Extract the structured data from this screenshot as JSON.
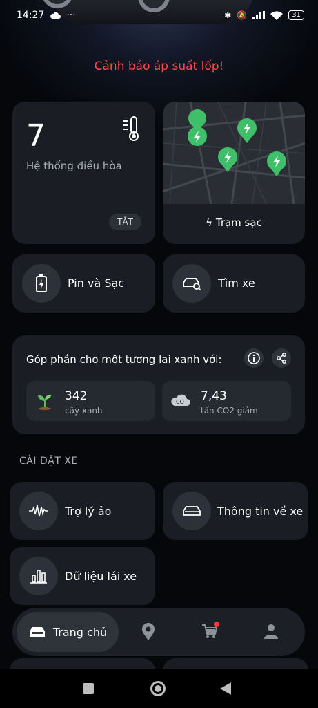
{
  "status_bar": {
    "time": "14:27",
    "battery": "31"
  },
  "alert": "Cảnh báo áp suất lốp!",
  "climate": {
    "value": "7",
    "label": "Hệ thống điều hòa",
    "off_label": "TẮT"
  },
  "charging_station": {
    "label": "Trạm sạc"
  },
  "battery_charge": {
    "label": "Pin và Sạc"
  },
  "find_car": {
    "label": "Tìm xe"
  },
  "eco": {
    "title": "Góp phần cho một tương lai xanh với:",
    "trees": {
      "value": "342",
      "unit": "cây xanh"
    },
    "co2": {
      "value": "7,43",
      "unit": "tấn CO2 giảm"
    }
  },
  "settings": {
    "title": "CÀI ĐẶT XE",
    "assistant": "Trợ lý ảo",
    "car_info": "Thông tin về xe",
    "driving_data": "Dữ liệu lái xe"
  },
  "nav": {
    "home": "Trang chủ"
  },
  "colors": {
    "alert": "#ff4a4a",
    "marker": "#3fbf6a",
    "card": "#1a1d23"
  }
}
